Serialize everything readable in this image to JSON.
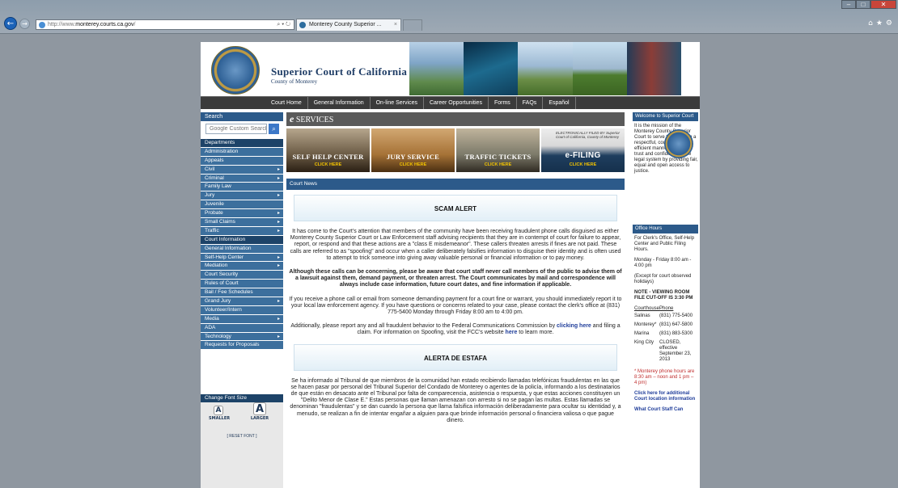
{
  "browser": {
    "address_prefix": "http://www.",
    "address_domain": "monterey.courts.ca.gov",
    "address_suffix": "/",
    "address_controls": "⌕ ▾ ↻",
    "tab_title": "Monterey County Superior ...",
    "tab_close": "×",
    "toolbar_icons": "⌂★⚙",
    "back_glyph": "←",
    "forward_glyph": "→",
    "minimize_glyph": "–",
    "maximize_glyph": "□",
    "close_glyph": "✕"
  },
  "header": {
    "title": "Superior Court of California",
    "subtitle": "County of Monterey"
  },
  "topnav": [
    "Court Home",
    "General Information",
    "On-line Services",
    "Career Opportunities",
    "Forms",
    "FAQs",
    "Español"
  ],
  "sidebar": {
    "search_label": "Search",
    "search_placeholder": "Google Custom Search",
    "search_glyph": "⌕",
    "items": [
      {
        "label": "Departments",
        "header": true,
        "arrow": false
      },
      {
        "label": "Administration",
        "arrow": false
      },
      {
        "label": "Appeals",
        "arrow": false
      },
      {
        "label": "Civil",
        "arrow": true
      },
      {
        "label": "Criminal",
        "arrow": true
      },
      {
        "label": "Family Law",
        "arrow": false
      },
      {
        "label": "Jury",
        "arrow": true
      },
      {
        "label": "Juvenile",
        "arrow": false
      },
      {
        "label": "Probate",
        "arrow": true
      },
      {
        "label": "Small Claims",
        "arrow": true
      },
      {
        "label": "Traffic",
        "arrow": true
      },
      {
        "label": "Court Information",
        "header": true,
        "arrow": false
      },
      {
        "label": "General Information",
        "arrow": false
      },
      {
        "label": "Self-Help Center",
        "arrow": true
      },
      {
        "label": "Mediation",
        "arrow": true
      },
      {
        "label": "Court Security",
        "arrow": false
      },
      {
        "label": "Rules of Court",
        "arrow": false
      },
      {
        "label": "Bail / Fee Schedules",
        "arrow": false
      },
      {
        "label": "Grand Jury",
        "arrow": true
      },
      {
        "label": "Volunteer/Intern",
        "arrow": false
      },
      {
        "label": "Media",
        "arrow": true
      },
      {
        "label": "ADA",
        "arrow": false
      },
      {
        "label": "Technology",
        "arrow": true
      },
      {
        "label": "Requests for Proposals",
        "arrow": false
      }
    ],
    "arrow_glyph": "▸",
    "font_size_header": "Change Font Size",
    "font_glyph": "A",
    "smaller_label": "SMALLER",
    "larger_label": "LARGER",
    "reset_label": "[ RESET FONT ]"
  },
  "main": {
    "eservices_e": "e",
    "eservices_label": "SERVICES",
    "tiles": [
      {
        "title": "SELF HELP CENTER",
        "click": "CLICK HERE"
      },
      {
        "title": "JURY SERVICE",
        "click": "CLICK HERE"
      },
      {
        "title": "TRAFFIC TICKETS",
        "click": "CLICK HERE"
      },
      {
        "title": "e-FILING",
        "click": "CLICK HERE",
        "stamp": "ELECTRONICALLY FILED BY Superior Court of California, County of Monterey"
      }
    ],
    "court_news": "Court News",
    "scam_title": "SCAM ALERT",
    "scam_p1": "It has come to the Court's attention that members of the community have been receiving fraudulent phone calls disguised as either Monterey County Superior Court or Law Enforcement staff advising recipients that they are in contempt of court for failure to appear, report, or respond and that these actions are a \"class E misdemeanor\". These callers threaten arrests if fines are not paid. These calls are referred to as \"spoofing\" and occur when a caller deliberately falsifies information to disguise their identity and is often used to attempt to trick someone into giving away valuable personal or financial information or to pay money.",
    "scam_p2": "Although these calls can be concerning, please be aware that court staff never call members of the public to advise them of a lawsuit against them, demand payment, or threaten arrest. The Court communicates by mail and correspondence will always include case information, future court dates, and fine information if applicable.",
    "scam_p3": "If you receive a phone call or email from someone demanding payment for a court fine or warrant, you should immediately report it to your local law enforcement agency. If you have questions or concerns related to your case, please contact the clerk's office at (831) 775-5400 Monday through Friday 8:00 am to 4:00 pm.",
    "scam_p4_a": "Additionally, please report any and all fraudulent behavior to the Federal Communications Commission by",
    "scam_p4_link1": "clicking here",
    "scam_p4_b": "and filing a claim. For information on Spoofing, visit the FCC's website",
    "scam_p4_link2": "here",
    "scam_p4_c": "to learn more.",
    "alerta_title": "ALERTA DE ESTAFA",
    "alerta_p1": "Se ha informado al Tribunal de que miembros de la comunidad han estado recibiendo llamadas telefónicas fraudulentas en las que se hacen pasar por personal del Tribunal Superior del Condado de Monterey o agentes de la policía, informando a los destinatarios de que están en desacato ante el Tribunal por falta de comparecencia, asistencia o respuesta, y que estas acciones constituyen un \"Delito Menor de Clase E.\" Estas personas que llaman amenazan con arresto si no se pagan las multas. Estas llamadas se denominan \"fraudulentas\" y se dan cuando la persona que llama falsifica información deliberadamente para ocultar su identidad y, a menudo, se realizan a fin de intentar engañar a alguien para que brinde información personal o financiera valiosa o que pague dinero."
  },
  "rightbar": {
    "welcome_title": "Welcome to Superior Court",
    "welcome_text": "It is the mission of the Monterey County Superior Court to serve the public in a respectful, courteous and efficient manner promoting trust and confidence in the legal system by providing fair, equal and open access to justice.",
    "office_hours_title": "Office Hours",
    "oh_p1": "For Clerk's Office, Self-Help Center and Public Filing Hours.",
    "oh_p2": "Monday - Friday 8:00 am - 4:00 pm",
    "oh_p3": "(Except for court observed holidays)",
    "oh_note": "NOTE - VIEWING ROOM FILE CUT-OFF IS 3:30 PM",
    "phone_col1": "Courthouse",
    "phone_col2": "Phone",
    "phones": [
      {
        "place": "Salinas",
        "phone": "(831) 775-5400"
      },
      {
        "place": "Monterey*",
        "phone": "(831) 647-5800"
      },
      {
        "place": "Marina",
        "phone": "(831) 883-5300"
      },
      {
        "place": "King City",
        "phone": "CLOSED, effective September 23, 2013"
      }
    ],
    "footnote": "* Monterey phone hours are 8:30 am – noon and 1 pm – 4 pm)",
    "link1": "Click here for additional Court location information",
    "link2": "What Court Staff Can"
  }
}
